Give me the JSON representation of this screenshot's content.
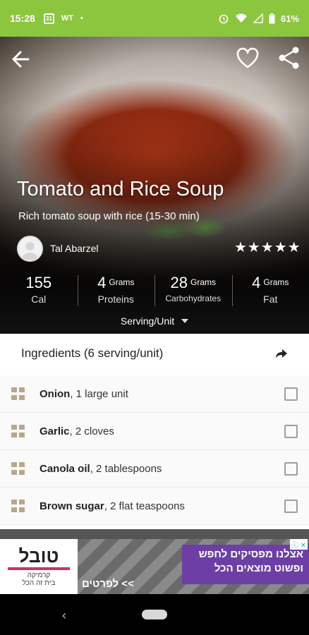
{
  "status_bar": {
    "time": "15:28",
    "calendar_day": "31",
    "notif_label": "WT",
    "dot": "•",
    "battery": "61%"
  },
  "recipe": {
    "title": "Tomato and Rice Soup",
    "subtitle": "Rich tomato soup with rice (15-30 min)",
    "author": "Tal Abarzel",
    "rating_stars": "★★★★★",
    "nutrition": [
      {
        "value": "155",
        "unit": "",
        "label": "Cal"
      },
      {
        "value": "4",
        "unit": "Grams",
        "label": "Proteins"
      },
      {
        "value": "28",
        "unit": "Grams",
        "label": "Carbohydrates"
      },
      {
        "value": "4",
        "unit": "Grams",
        "label": "Fat"
      }
    ],
    "serving_selector": "Serving/Unit"
  },
  "ingredients": {
    "header": "Ingredients (6 serving/unit)",
    "items": [
      {
        "name": "Onion",
        "amount": ", 1 large unit"
      },
      {
        "name": "Garlic",
        "amount": ", 2 cloves"
      },
      {
        "name": "Canola oil",
        "amount": ", 2 tablespoons"
      },
      {
        "name": "Brown sugar",
        "amount": ", 2 flat teaspoons"
      }
    ]
  },
  "ad": {
    "brand": "טובל",
    "brand_tagline": "בית זה הכל",
    "brand_sub": "קרמיקה",
    "headline": "אצלנו מפסיקים לחפש ופשוט מוצאים הכל",
    "cta": "לפרטים <<",
    "adchoices": "ⓘ ✕"
  },
  "nav": {
    "back": "‹"
  }
}
